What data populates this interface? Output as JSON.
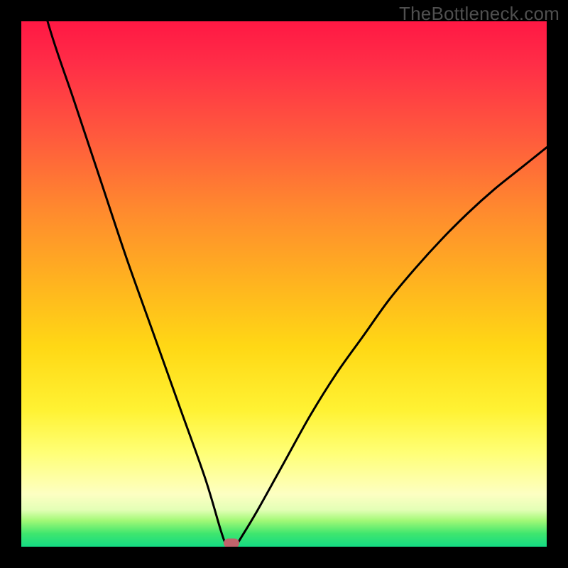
{
  "watermark": "TheBottleneck.com",
  "chart_data": {
    "type": "line",
    "title": "",
    "xlabel": "",
    "ylabel": "",
    "xlim": [
      0,
      100
    ],
    "ylim": [
      0,
      100
    ],
    "series": [
      {
        "name": "bottleneck-curve",
        "x": [
          0,
          5,
          10,
          15,
          20,
          25,
          30,
          35,
          38,
          39,
          40,
          41,
          42,
          45,
          50,
          55,
          60,
          65,
          70,
          75,
          80,
          85,
          90,
          95,
          100
        ],
        "values": [
          120,
          100,
          85,
          70,
          55,
          41,
          27,
          13,
          3,
          0.5,
          0,
          0.5,
          2,
          7,
          16,
          25,
          33,
          40,
          47,
          53,
          58.5,
          63.5,
          68,
          72,
          76
        ]
      }
    ],
    "annotations": [
      {
        "name": "optimal-marker",
        "x": 40,
        "y": 0,
        "color": "#c0636b"
      }
    ],
    "background_gradient": {
      "top": "#ff1844",
      "bottom": "#14db83",
      "meaning": "red=high bottleneck, green=low bottleneck"
    }
  }
}
